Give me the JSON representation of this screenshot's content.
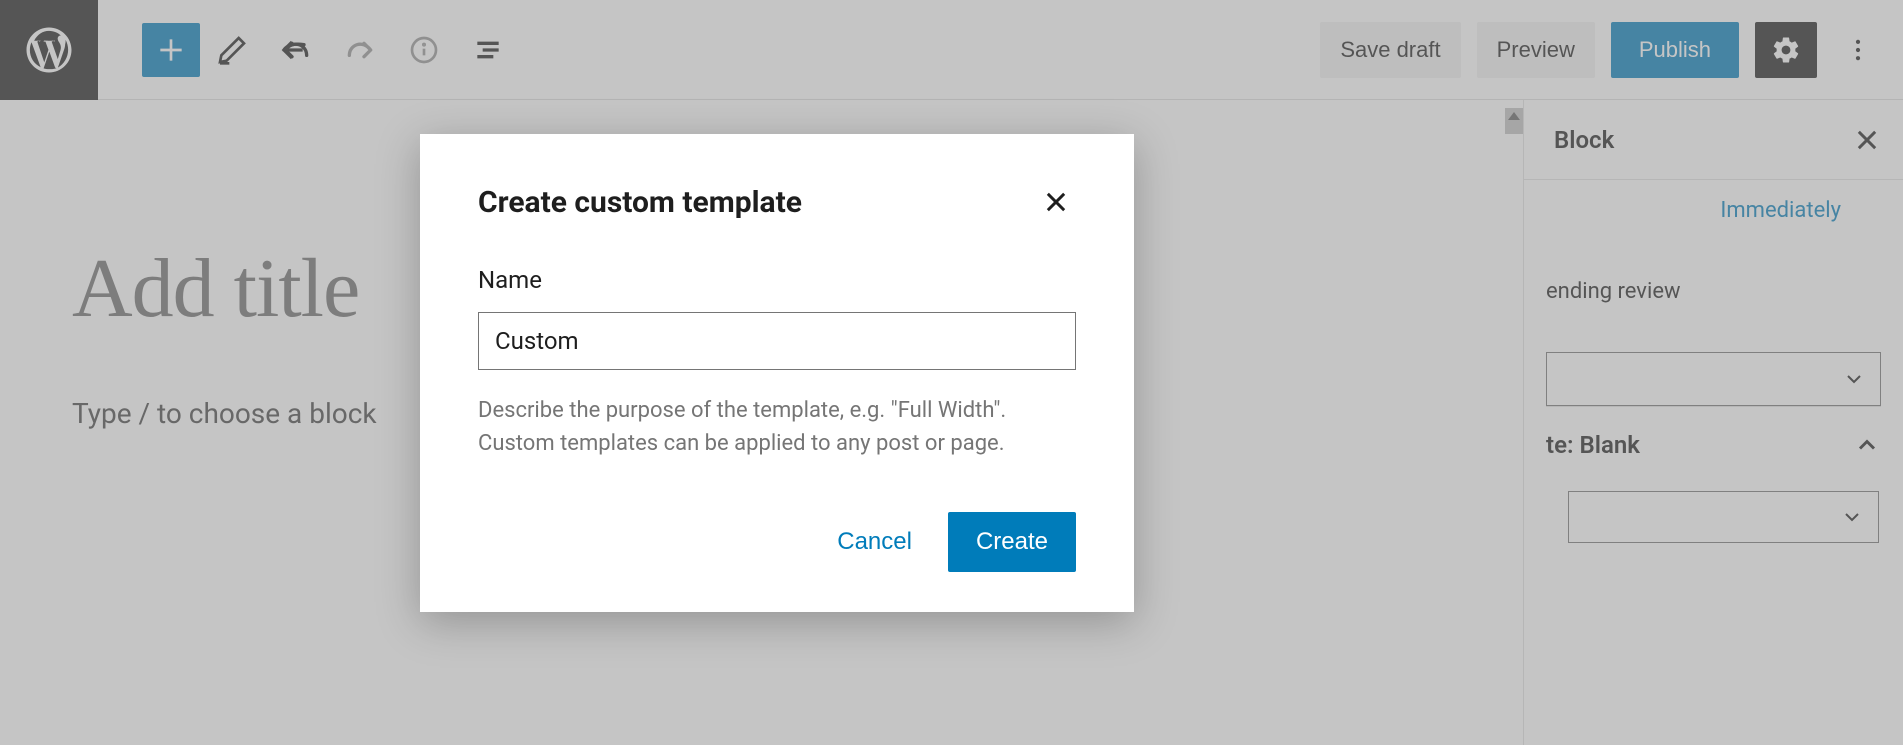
{
  "topbar": {
    "save_draft": "Save draft",
    "preview": "Preview",
    "publish": "Publish"
  },
  "editor": {
    "title_placeholder": "Add title",
    "body_placeholder": "Type / to choose a block"
  },
  "sidebar": {
    "tab_block": "Block",
    "publish_value": "Immediately",
    "pending_review": "ending review",
    "template_panel": "te: Blank"
  },
  "modal": {
    "title": "Create custom template",
    "name_label": "Name",
    "name_value": "Custom",
    "help_text": "Describe the purpose of the template, e.g. \"Full Width\". Custom templates can be applied to any post or page.",
    "cancel": "Cancel",
    "create": "Create"
  }
}
